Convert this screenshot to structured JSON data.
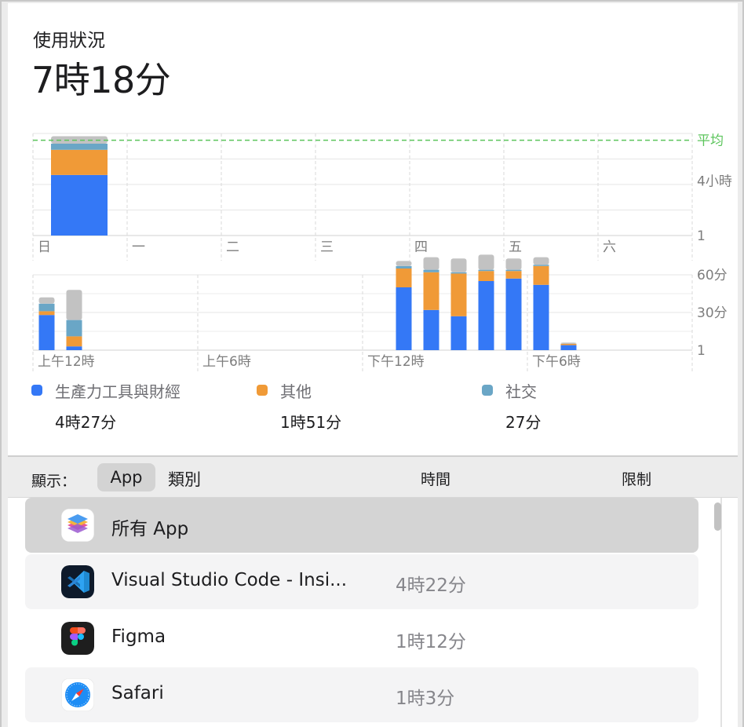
{
  "summary": {
    "title": "使用狀況",
    "total": "7時18分"
  },
  "chart_data": [
    {
      "type": "bar",
      "stacked": true,
      "categories": [
        "日",
        "一",
        "二",
        "三",
        "四",
        "五",
        "六"
      ],
      "series": [
        {
          "name": "生產力工具與財經",
          "values": [
            4.45,
            0,
            0,
            0,
            0,
            0,
            0
          ]
        },
        {
          "name": "其他",
          "values": [
            1.85,
            0,
            0,
            0,
            0,
            0,
            0
          ]
        },
        {
          "name": "社交",
          "values": [
            0.45,
            0,
            0,
            0,
            0,
            0,
            0
          ]
        },
        {
          "name": "",
          "values": [
            0.55,
            0,
            0,
            0,
            0,
            0,
            0
          ]
        }
      ],
      "average_label": "平均",
      "y_tick_labels": [
        "1",
        "4小時",
        "平均"
      ],
      "ylim": [
        0,
        7.5
      ],
      "grid": true
    },
    {
      "type": "bar",
      "stacked": true,
      "categories": [
        "0",
        "1",
        "2",
        "3",
        "4",
        "5",
        "6",
        "7",
        "8",
        "9",
        "10",
        "11",
        "12",
        "13",
        "14",
        "15",
        "16",
        "17",
        "18",
        "19",
        "20",
        "21",
        "22",
        "23"
      ],
      "x_tick_labels": [
        "上午12時",
        "上午6時",
        "下午12時",
        "下午6時"
      ],
      "series": [
        {
          "name": "生產力工具與財經",
          "values": [
            28,
            3,
            0,
            0,
            0,
            0,
            0,
            0,
            0,
            0,
            0,
            0,
            0,
            50,
            32,
            27,
            55,
            57,
            52,
            4,
            0,
            0,
            0,
            0
          ]
        },
        {
          "name": "其他",
          "values": [
            3,
            8,
            0,
            0,
            0,
            0,
            0,
            0,
            0,
            0,
            0,
            0,
            0,
            15,
            30,
            34,
            8,
            6,
            15,
            1,
            0,
            0,
            0,
            0
          ]
        },
        {
          "name": "社交",
          "values": [
            6,
            13,
            0,
            0,
            0,
            0,
            0,
            0,
            0,
            0,
            0,
            0,
            0,
            2,
            2,
            1,
            1,
            1,
            1,
            0,
            0,
            0,
            0,
            0
          ]
        },
        {
          "name": "",
          "values": [
            5,
            24,
            0,
            0,
            0,
            0,
            0,
            0,
            0,
            0,
            0,
            0,
            0,
            4,
            10,
            11,
            12,
            9,
            6,
            1,
            0,
            0,
            0,
            0
          ]
        }
      ],
      "y_tick_labels": [
        "1",
        "30分",
        "60分"
      ],
      "ylim": [
        0,
        60
      ],
      "grid": true
    }
  ],
  "legend": [
    {
      "label": "生產力工具與財經",
      "value": "4時27分",
      "color": "#3478f6"
    },
    {
      "label": "其他",
      "value": "1時51分",
      "color": "#f09a37"
    },
    {
      "label": "社交",
      "value": "27分",
      "color": "#6aa6c6"
    }
  ],
  "colors": {
    "productivity": "#3478f6",
    "other": "#f09a37",
    "social": "#6aa6c6",
    "rest": "#c2c2c2",
    "average_line": "#5cc55c"
  },
  "table_header": {
    "show_label": "顯示：",
    "seg_app": "App",
    "seg_category": "類別",
    "col_time": "時間",
    "col_limit": "限制"
  },
  "apps": [
    {
      "name": "所有 App",
      "time": "",
      "icon": "layers-icon"
    },
    {
      "name": "Visual Studio Code - Insi...",
      "time": "4時22分",
      "icon": "vscode-icon"
    },
    {
      "name": "Figma",
      "time": "1時12分",
      "icon": "figma-icon"
    },
    {
      "name": "Safari",
      "time": "1時3分",
      "icon": "safari-compass-icon"
    }
  ]
}
